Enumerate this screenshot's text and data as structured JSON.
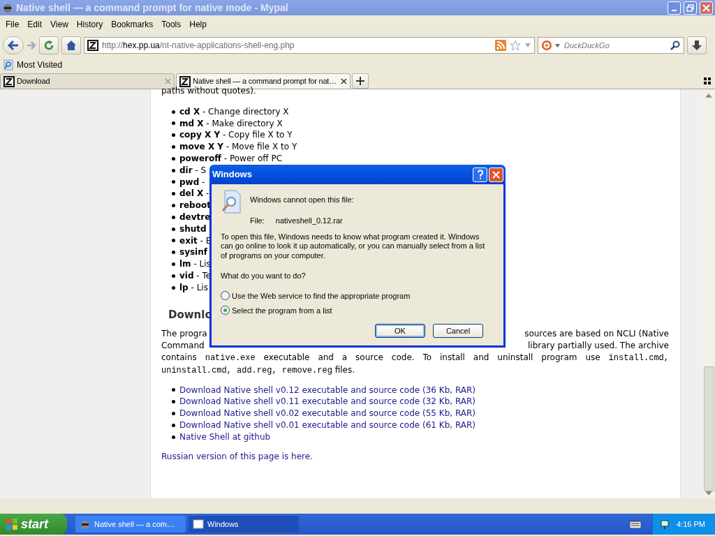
{
  "window": {
    "title": "Native shell — a command prompt for native mode - Mypal"
  },
  "menu": [
    "File",
    "Edit",
    "View",
    "History",
    "Bookmarks",
    "Tools",
    "Help"
  ],
  "address": {
    "parts": [
      {
        "text": "http://",
        "emphasis": false
      },
      {
        "text": "hex.pp.ua",
        "emphasis": true
      },
      {
        "text": "/nt-native-applications-shell-eng.php",
        "emphasis": false
      }
    ]
  },
  "search": {
    "placeholder": "DuckDuckGo"
  },
  "bookmarks": [
    "Most Visited"
  ],
  "tabs": [
    {
      "label": "Download",
      "selected": false
    },
    {
      "label": "Native shell — a command prompt for nat…",
      "selected": true
    }
  ],
  "page": {
    "intro_tail": "paths without quotes).",
    "commands": [
      {
        "cmd": "cd X",
        "desc": "- Change directory X"
      },
      {
        "cmd": "md X",
        "desc": "- Make directory X"
      },
      {
        "cmd": "copy X Y",
        "desc": "- Copy file X to Y"
      },
      {
        "cmd": "move X Y",
        "desc": "- Move file X to Y"
      },
      {
        "cmd": "poweroff",
        "desc": "- Power off PC"
      },
      {
        "cmd": "dir",
        "desc": "- S"
      },
      {
        "cmd": "pwd",
        "desc": "-"
      },
      {
        "cmd": "del X",
        "desc": "-"
      },
      {
        "cmd": "reboot"
      },
      {
        "cmd": "devtre"
      },
      {
        "cmd": "shutd"
      },
      {
        "cmd": "exit",
        "desc": "- E"
      },
      {
        "cmd": "sysinf"
      },
      {
        "cmd": "lm",
        "desc": "- Lis"
      },
      {
        "cmd": "vid",
        "desc": "- Te"
      },
      {
        "cmd": "lp",
        "desc": "- Lis"
      }
    ],
    "heading": "Downlo",
    "para_line_1": [
      "The progra",
      "sources are based on NCLI (Native"
    ],
    "para_line_2": [
      "Command",
      "library partially used. The archive"
    ],
    "para_line_3": [
      {
        "text": "contains ",
        "kind": "text"
      },
      {
        "text": "native.exe",
        "kind": "code"
      },
      {
        "text": " executable and a source code. To install and uninstall program use ",
        "kind": "text"
      },
      {
        "text": "install.cmd,",
        "kind": "code"
      }
    ],
    "para_line_4": [
      {
        "text": "uninstall.cmd, add.reg, remove.reg",
        "kind": "code"
      },
      {
        "text": " files.",
        "kind": "text"
      }
    ],
    "links": [
      "Download Native shell v0.12 executable and source code (36 Kb, RAR)",
      "Download Native shell v0.11 executable and source code (32 Kb, RAR)",
      "Download Native shell v0.02 executable and source code (55 Kb, RAR)",
      "Download Native shell v0.01 executable and source code (61 Kb, RAR)",
      "Native Shell at github"
    ],
    "footer_link": "Russian version of this page is here."
  },
  "dialog": {
    "title": "Windows",
    "message": "Windows cannot open this file:",
    "file_label": "File:",
    "file_name": "nativeshell_0.12.rar",
    "body": "To open this file, Windows needs to know what program created it.  Windows can go online to look it up automatically, or you can manually select from a list of programs on your computer.",
    "question": "What do you want to do?",
    "options": [
      {
        "label": "Use the Web service to find the appropriate program",
        "selected": false
      },
      {
        "label": "Select the program from a list",
        "selected": true
      }
    ],
    "buttons": [
      {
        "label": "OK",
        "default": true
      },
      {
        "label": "Cancel",
        "default": false
      }
    ]
  },
  "taskbar": {
    "start": "start",
    "tasks": [
      {
        "label": "Native shell — a com…",
        "selected": false
      },
      {
        "label": "Windows",
        "selected": true
      }
    ],
    "clock": "4:16 PM"
  }
}
